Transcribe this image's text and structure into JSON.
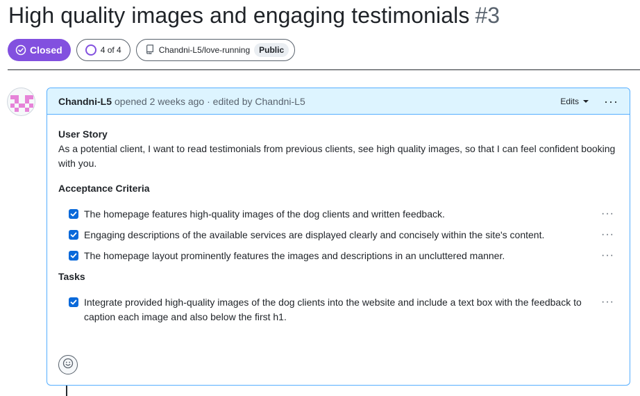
{
  "issue": {
    "title": "High quality images and engaging testimonials",
    "number": "#3"
  },
  "meta": {
    "state_label": "Closed",
    "progress_label": "4 of 4",
    "repo_label": "Chandni-L5/love-running",
    "visibility_label": "Public"
  },
  "comment": {
    "author": "Chandni-L5",
    "activity": "opened 2 weeks ago · edited by Chandni-L5",
    "edits_label": "Edits",
    "more_label": "···",
    "body": {
      "story_heading": "User Story",
      "story_text": "As a potential client, I want to read testimonials from previous clients, see high quality images, so that I can feel confident booking with you.",
      "criteria_heading": "Acceptance Criteria",
      "criteria": [
        {
          "text": "The homepage features high-quality images of the dog clients and written feedback.",
          "checked": true
        },
        {
          "text": "Engaging descriptions of the available services are displayed clearly and concisely within the site's content.",
          "checked": true
        },
        {
          "text": "The homepage layout prominently features the images and descriptions in an uncluttered manner.",
          "checked": true
        }
      ],
      "tasks_heading": "Tasks",
      "tasks": [
        {
          "text": "Integrate provided high-quality images of the dog clients into the website and include a text box with the feedback to caption each image and also below the first h1.",
          "checked": true
        }
      ],
      "item_more_label": "···"
    }
  },
  "colors": {
    "closed_purple": "#8250df",
    "header_blue_bg": "#ddf4ff",
    "accent_border": "#54aeff",
    "checkbox_blue": "#0969da"
  },
  "icons": {
    "state": "check-circle-icon",
    "progress": "progress-ring-icon",
    "repo": "repo-icon",
    "reaction": "smiley-icon"
  }
}
